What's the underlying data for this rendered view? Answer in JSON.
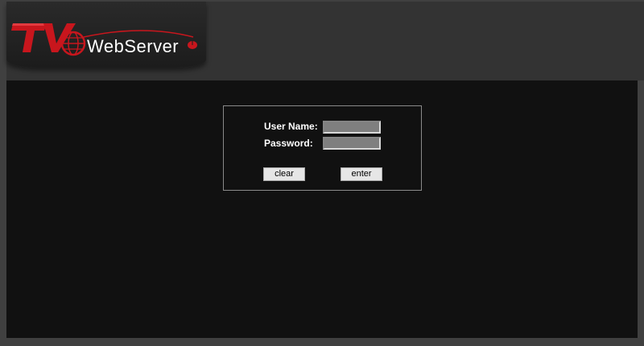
{
  "logo": {
    "mark": "TV",
    "brand_text": "WebServer",
    "colors": {
      "red": "#c8161d",
      "dark_red": "#8e0f14",
      "white": "#ffffff"
    }
  },
  "login": {
    "username_label": "User Name:",
    "password_label": "Password:",
    "username_value": "",
    "password_value": "",
    "clear_label": "clear",
    "enter_label": "enter"
  }
}
